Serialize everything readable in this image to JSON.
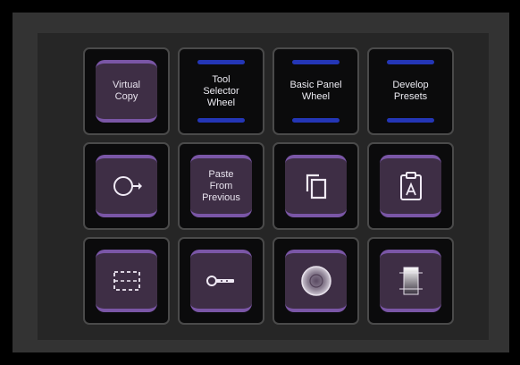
{
  "keys": [
    {
      "id": "virtual-copy",
      "style": "pad",
      "label": "Virtual\nCopy"
    },
    {
      "id": "tool-selector-wheel",
      "style": "wheel",
      "label": "Tool\nSelector\nWheel"
    },
    {
      "id": "basic-panel-wheel",
      "style": "wheel",
      "label": "Basic Panel\nWheel"
    },
    {
      "id": "develop-presets",
      "style": "wheel",
      "label": "Develop\nPresets"
    },
    {
      "id": "rotate-arrow",
      "style": "pad",
      "icon": "circle-arrow-icon"
    },
    {
      "id": "paste-from-previous",
      "style": "pad",
      "label": "Paste\nFrom\nPrevious"
    },
    {
      "id": "copy",
      "style": "pad",
      "icon": "copy-icon"
    },
    {
      "id": "paste-settings",
      "style": "pad",
      "icon": "clipboard-a-icon"
    },
    {
      "id": "crop",
      "style": "pad",
      "icon": "dashed-crop-icon"
    },
    {
      "id": "key-tool",
      "style": "pad",
      "icon": "key-icon"
    },
    {
      "id": "radial-filter",
      "style": "pad",
      "icon": "radial-circle-icon"
    },
    {
      "id": "graduated-filter",
      "style": "pad",
      "icon": "gradient-filter-icon"
    }
  ],
  "colors": {
    "pad": "#3e2e45",
    "pad_accent": "#7a56a6",
    "wheel_bar": "#2436b6"
  }
}
